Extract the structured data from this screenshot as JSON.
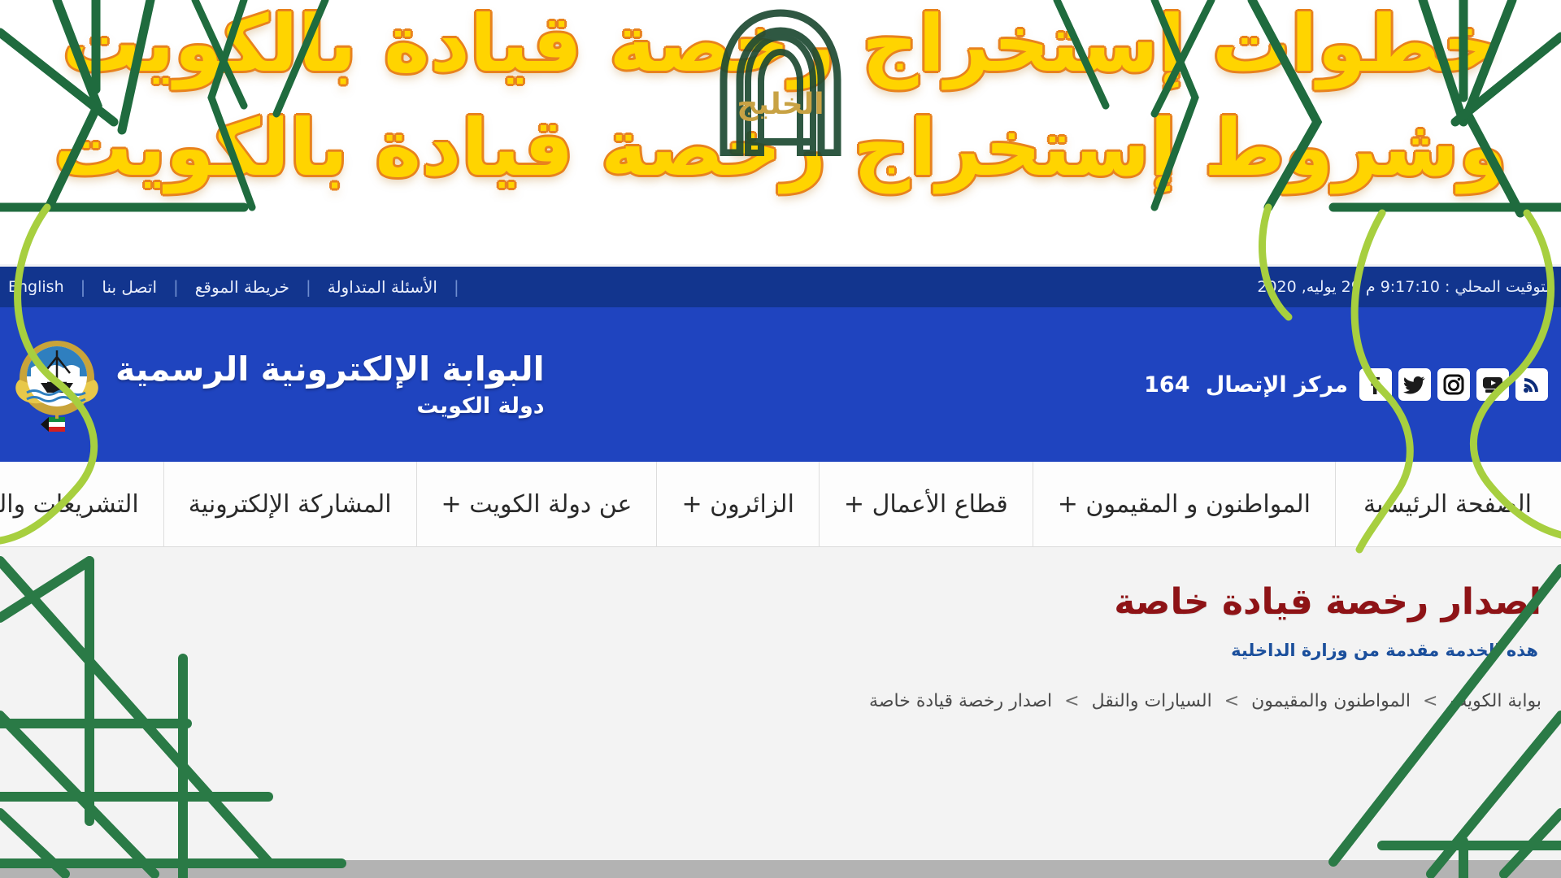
{
  "banner": {
    "headline_line1": "خطوات إستخراج رخصة قيادة بالكويت",
    "headline_line2": "وشروط إستخراج رخصة قيادة بالكويت",
    "watermark_label": "الخليج",
    "watermark_icon": "arch-logo-icon",
    "text_color": "#ffd400",
    "outline_color": "#e8821e"
  },
  "topbar": {
    "datetime": "التوقيت المحلي : 9:17:10 م 29 يوليه, 2020",
    "links": [
      {
        "label": "الأسئلة المتداولة"
      },
      {
        "label": "خريطة الموقع"
      },
      {
        "label": "اتصل بنا"
      },
      {
        "label": "English"
      }
    ],
    "separator": "|",
    "background": "#12358e"
  },
  "masthead": {
    "title": "البوابة الإلكترونية الرسمية",
    "subtitle": "دولة  الكويت",
    "emblem_icon": "kuwait-state-emblem-icon",
    "contact_label": "مركز الإتصال",
    "contact_number": "164",
    "background": "#1f44bf",
    "social": [
      {
        "name": "facebook-icon",
        "glyph": "f"
      },
      {
        "name": "twitter-icon",
        "glyph": "t"
      },
      {
        "name": "instagram-icon",
        "glyph": "i"
      },
      {
        "name": "youtube-icon",
        "glyph": "y"
      },
      {
        "name": "rss-icon",
        "glyph": "r"
      }
    ]
  },
  "mainnav": {
    "items": [
      {
        "label": "الصفحة الرئيسية",
        "name": "nav-home"
      },
      {
        "label": "المواطنون و المقيمون +",
        "name": "nav-citizens-residents"
      },
      {
        "label": "قطاع الأعمال +",
        "name": "nav-business"
      },
      {
        "label": "الزائرون +",
        "name": "nav-visitors"
      },
      {
        "label": "عن دولة الكويت +",
        "name": "nav-about-kuwait"
      },
      {
        "label": "المشاركة الإلكترونية",
        "name": "nav-eparticipation"
      },
      {
        "label": "التشريعات والقوانين",
        "name": "nav-legislation"
      }
    ]
  },
  "content": {
    "page_title": "اصدار رخصة قيادة خاصة",
    "page_title_color": "#8e1316",
    "subtitle": "هذه الخدمة مقدمة من وزارة الداخلية",
    "subtitle_color": "#1b4f9c",
    "breadcrumb": {
      "separator": ">",
      "items": [
        {
          "label": "بوابة الكويت"
        },
        {
          "label": "المواطنون والمقيمون"
        },
        {
          "label": "السيارات والنقل"
        },
        {
          "label": "اصدار رخصة قيادة خاصة"
        }
      ]
    }
  },
  "decor": {
    "vine_color_dark": "#1f6b3e",
    "vine_color_light": "#a7cf3f",
    "bottom_bar_color": "#b3b3b3"
  }
}
